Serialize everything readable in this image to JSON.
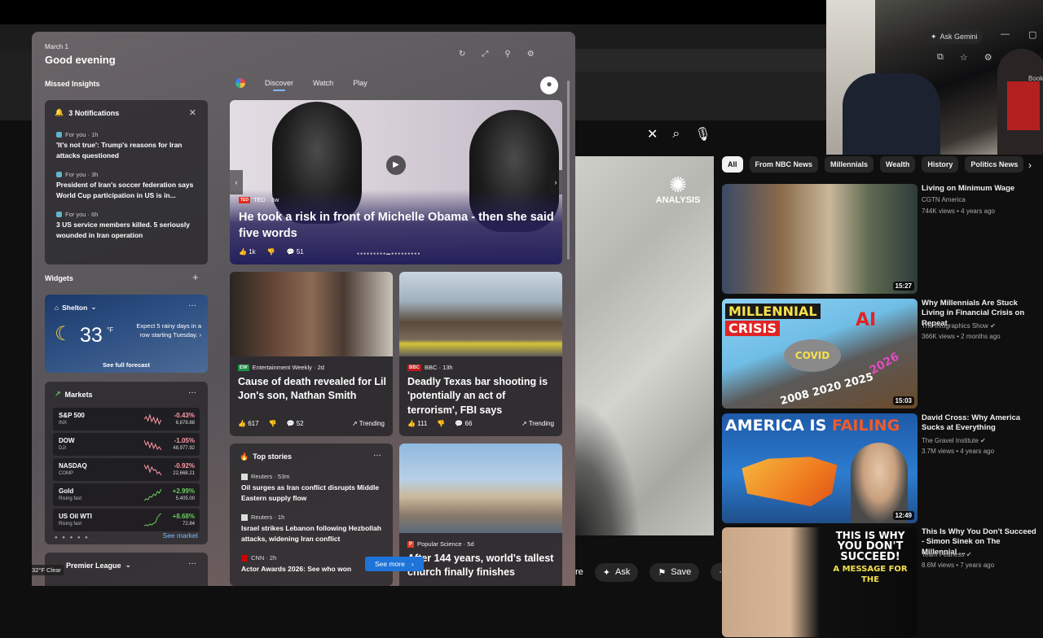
{
  "browser": {
    "ask_gemini": "Ask Gemini",
    "bookmarks_label": "Book"
  },
  "youtube": {
    "chips": [
      "All",
      "From NBC News",
      "Millennials",
      "Wealth",
      "History",
      "Politics News"
    ],
    "video_overlay": "ANALYSIS",
    "controls": {
      "ask": "Ask",
      "save": "Save",
      "share_tail": "re"
    },
    "recommendations": [
      {
        "title": "Living on Minimum Wage",
        "channel": "CGTN America",
        "meta": "744K views • 4 years ago",
        "duration": "15:27",
        "thumb_text": ""
      },
      {
        "title": "Why Millennials Are Stuck Living in Financial Crisis on Repeat",
        "channel": "The Infographics Show",
        "meta": "366K views • 2 months ago",
        "duration": "15:03",
        "thumb_text": "MILLENNIAL CRISIS",
        "thumb_extra": [
          "AI",
          "COVID",
          "2026",
          "2008 2020 2025"
        ]
      },
      {
        "title": "David Cross: Why America Sucks at Everything",
        "channel": "The Gravel Institute",
        "meta": "3.7M views • 4 years ago",
        "duration": "12:49",
        "thumb_text": "AMERICA IS FAILING"
      },
      {
        "title": "This Is Why You Don't Succeed - Simon Sinek on The Millennial ...",
        "channel": "Team Fearless",
        "meta": "8.6M views • 7 years ago",
        "duration": "",
        "thumb_text": "THIS IS WHY YOU DON'T SUCCEED! A MESSAGE FOR THE"
      }
    ]
  },
  "panel": {
    "date": "March 1",
    "greeting": "Good evening",
    "missed_label": "Missed Insights",
    "notifications": {
      "header": "3 Notifications",
      "items": [
        {
          "source": "For you · 1h",
          "text": "'It's not true': Trump's reasons for Iran attacks questioned"
        },
        {
          "source": "For you · 3h",
          "text": "President of Iran's soccer federation says World Cup participation in US is in..."
        },
        {
          "source": "For you · 6h",
          "text": "3 US service members killed. 5 seriously wounded in Iran operation"
        }
      ]
    },
    "widgets_label": "Widgets",
    "weather": {
      "location": "Shelton",
      "temp": "33",
      "unit": "°F",
      "forecast": "Expect 5 rainy days in a row starting Tuesday.",
      "link": "See full forecast"
    },
    "markets": {
      "header": "Markets",
      "rows": [
        {
          "name": "S&P 500",
          "sub": "INX",
          "change": "-0.43%",
          "value": "6,878.88",
          "color": "#ff99a4"
        },
        {
          "name": "DOW",
          "sub": "DJI",
          "change": "-1.05%",
          "value": "48,977.92",
          "color": "#ff99a4"
        },
        {
          "name": "NASDAQ",
          "sub": "COMP",
          "change": "-0.92%",
          "value": "22,668.21",
          "color": "#ff99a4"
        },
        {
          "name": "Gold",
          "sub": "Rising fast",
          "change": "+2.99%",
          "value": "5,405.00",
          "color": "#6ccb5f"
        },
        {
          "name": "US Oil WTI",
          "sub": "Rising fast",
          "change": "+8.68%",
          "value": "72.84",
          "color": "#6ccb5f"
        }
      ],
      "see_market": "See market"
    },
    "premier": {
      "header": "Premier League"
    },
    "status_clear": "32°F Clear"
  },
  "feed": {
    "tabs": [
      "Discover",
      "Watch",
      "Play"
    ],
    "hero": {
      "source": "TED · 3w",
      "badge": "TED",
      "title": "He took a risk in front of Michelle Obama - then she said five words",
      "likes": "1k",
      "comments": "51"
    },
    "cards": [
      {
        "source": "Entertainment Weekly · 2d",
        "icon": "EW",
        "title": "Cause of death revealed for Lil Jon's son, Nathan Smith",
        "likes": "617",
        "comments": "52",
        "trend": "Trending"
      },
      {
        "source": "BBC · 13h",
        "icon": "BBC",
        "title": "Deadly Texas bar shooting is 'potentially an act of terrorism', FBI says",
        "likes": "111",
        "comments": "66",
        "trend": "Trending"
      }
    ],
    "top_stories": {
      "header": "Top stories",
      "items": [
        {
          "source": "Reuters · 53m",
          "text": "Oil surges as Iran conflict disrupts Middle Eastern supply flow"
        },
        {
          "source": "Reuters · 1h",
          "text": "Israel strikes Lebanon following Hezbollah attacks, widening Iran conflict"
        },
        {
          "source": "CNN · 2h",
          "text": "Actor Awards 2026: See who won"
        }
      ]
    },
    "church": {
      "source": "Popular Science · 5d",
      "title": "After 144 years, world's tallest church finally finishes"
    },
    "see_more": "See more"
  }
}
